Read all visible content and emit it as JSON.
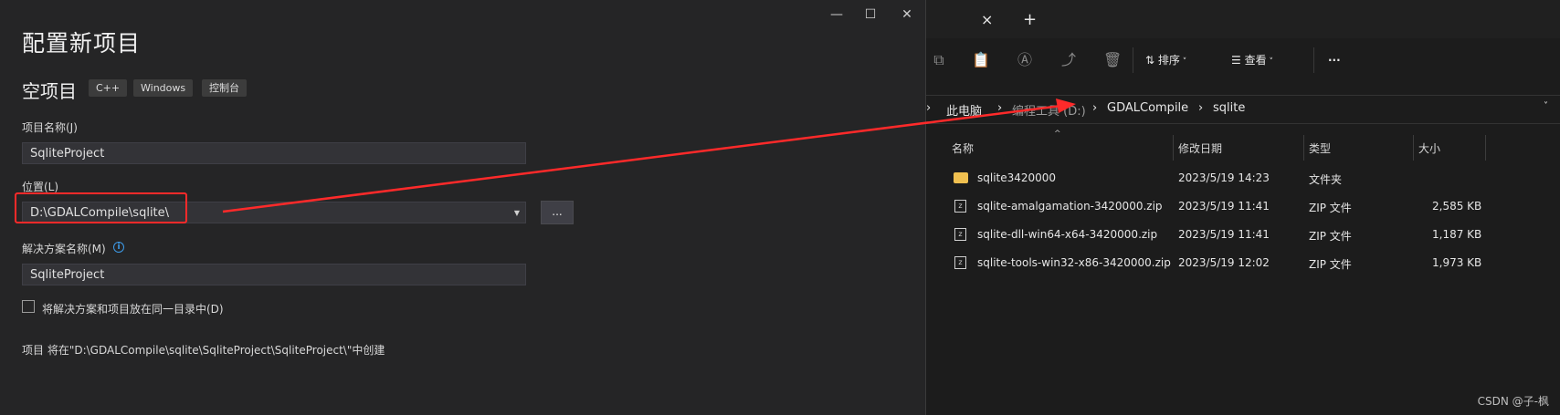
{
  "dialog": {
    "title": "配置新项目",
    "template_name": "空项目",
    "tags": [
      "C++",
      "Windows",
      "控制台"
    ],
    "project_name_label": "项目名称(J)",
    "project_name_value": "SqliteProject",
    "location_label": "位置(L)",
    "location_value": "D:\\GDALCompile\\sqlite\\",
    "browse_label": "...",
    "solution_name_label": "解决方案名称(M)",
    "solution_name_value": "SqliteProject",
    "same_dir_label": "将解决方案和项目放在同一目录中(D)",
    "create_note": "项目 将在\"D:\\GDALCompile\\sqlite\\SqliteProject\\SqliteProject\\\"中创建",
    "window_controls": [
      "minimize-icon",
      "maximize-icon",
      "close-icon"
    ]
  },
  "explorer": {
    "tab_close": "×",
    "tab_add": "+",
    "toolbar": {
      "sort_label": "排序",
      "view_label": "查看",
      "more_label": "···"
    },
    "breadcrumb": [
      "此电脑",
      "编程工具 (D:)",
      "GDALCompile",
      "sqlite"
    ],
    "columns": [
      "名称",
      "修改日期",
      "类型",
      "大小"
    ],
    "files": [
      {
        "name": "sqlite3420000",
        "date": "2023/5/19 14:23",
        "type": "文件夹",
        "size": "",
        "icon": "folder-icon"
      },
      {
        "name": "sqlite-amalgamation-3420000.zip",
        "date": "2023/5/19 11:41",
        "type": "ZIP 文件",
        "size": "2,585 KB",
        "icon": "zip-icon"
      },
      {
        "name": "sqlite-dll-win64-x64-3420000.zip",
        "date": "2023/5/19 11:41",
        "type": "ZIP 文件",
        "size": "1,187 KB",
        "icon": "zip-icon"
      },
      {
        "name": "sqlite-tools-win32-x86-3420000.zip",
        "date": "2023/5/19 12:02",
        "type": "ZIP 文件",
        "size": "1,973 KB",
        "icon": "zip-icon"
      }
    ]
  },
  "annotation": {
    "color": "#ff2a2a"
  },
  "watermark": "CSDN @子-枫"
}
